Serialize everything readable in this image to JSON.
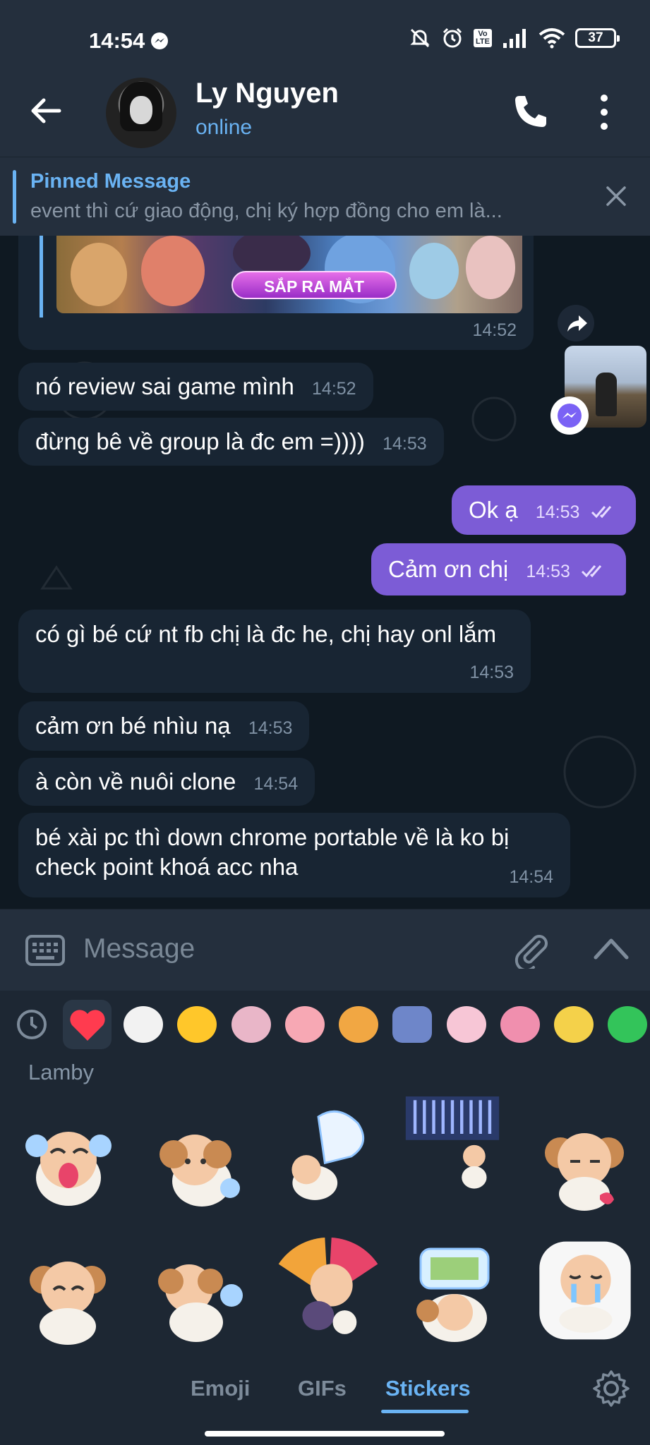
{
  "status_bar": {
    "time": "14:54",
    "battery": "37",
    "network": "LTE"
  },
  "header": {
    "name": "Ly Nguyen",
    "status": "online"
  },
  "pinned": {
    "title": "Pinned Message",
    "text": "event thì cứ giao động, chị ký hợp đồng cho em là..."
  },
  "image_card": {
    "time": "14:52",
    "banner_text": "SẮP RA MẮT"
  },
  "messages": [
    {
      "text": "nó review sai game mình",
      "time": "14:52",
      "direction": "in"
    },
    {
      "text": "đừng bê về group là đc em =))))",
      "time": "14:53",
      "direction": "in"
    },
    {
      "text": "Ok ạ",
      "time": "14:53",
      "direction": "out"
    },
    {
      "text": "Cảm ơn chị",
      "time": "14:53",
      "direction": "out"
    },
    {
      "text": "có gì bé cứ nt fb chị là đc he, chị hay onl lắm",
      "time": "14:53",
      "direction": "in"
    },
    {
      "text": "cảm ơn bé nhìu nạ",
      "time": "14:53",
      "direction": "in"
    },
    {
      "text": "à còn về nuôi clone",
      "time": "14:54",
      "direction": "in"
    },
    {
      "text": "bé xài pc thì down chrome portable về là ko bị check point khoá acc nha",
      "time": "14:54",
      "direction": "in"
    }
  ],
  "input": {
    "placeholder": "Message"
  },
  "sticker_panel": {
    "pack_name": "Lamby",
    "tabs": [
      "Emoji",
      "GIFs",
      "Stickers"
    ],
    "active_tab": "Stickers"
  },
  "colors": {
    "accent": "#6ab3f3",
    "outgoing": "#7c5cd6",
    "incoming": "#182533",
    "background": "#0f1922"
  }
}
